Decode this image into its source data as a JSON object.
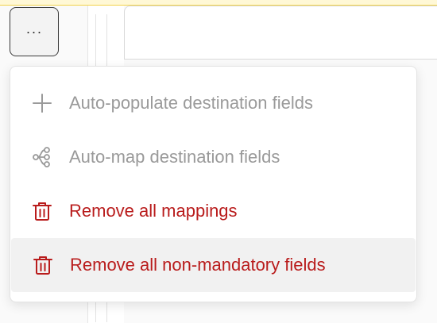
{
  "toolbar": {
    "more_button_label": "···"
  },
  "menu": {
    "items": [
      {
        "label": "Auto-populate destination fields",
        "icon": "plus-icon",
        "state": "disabled"
      },
      {
        "label": "Auto-map destination fields",
        "icon": "branch-icon",
        "state": "disabled"
      },
      {
        "label": "Remove all mappings",
        "icon": "trash-icon",
        "state": "danger"
      },
      {
        "label": "Remove all non-mandatory fields",
        "icon": "trash-icon",
        "state": "danger-hovered"
      }
    ]
  },
  "colors": {
    "danger": "#b91c1c",
    "disabled": "#9a9a9a",
    "hover_bg": "#f1f1f1",
    "accent_border": "#f2d24b"
  }
}
